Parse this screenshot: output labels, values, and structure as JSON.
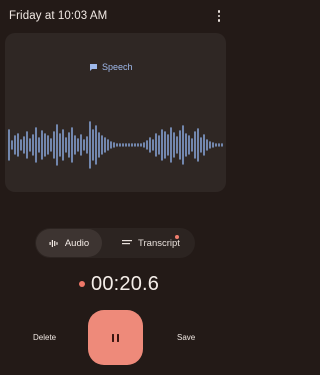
{
  "header": {
    "title": "Friday at 10:03 AM",
    "menu_icon": "more-vert-icon"
  },
  "waveform": {
    "label": "Speech",
    "label_icon": "speech-bubble-icon",
    "accent_color": "#8fb0e8"
  },
  "tabs": {
    "audio_label": "Audio",
    "audio_icon": "audio-bars-icon",
    "transcript_label": "Transcript",
    "transcript_icon": "transcript-lines-icon"
  },
  "timer": {
    "value": "00:20.6",
    "recording_color": "#ef7768"
  },
  "controls": {
    "delete_label": "Delete",
    "save_label": "Save",
    "pause_icon": "pause-icon",
    "pause_color": "#ee8a7a"
  }
}
